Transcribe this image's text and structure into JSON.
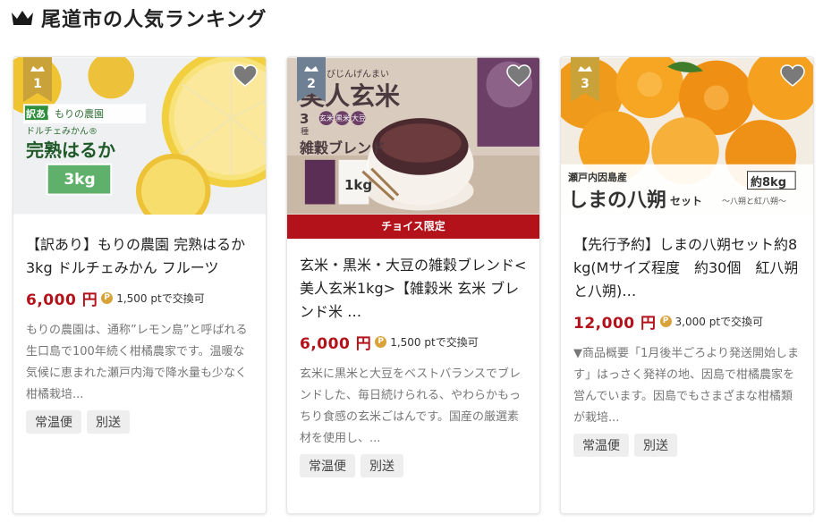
{
  "section": {
    "title": "尾道市の人気ランキング",
    "crown_icon": "crown-icon",
    "crown_color": "#1a1a1a"
  },
  "cards": [
    {
      "rank": "1",
      "rank_color": "#c9a23a",
      "image_text": {
        "tag": "訳あり",
        "farm": "もりの農園",
        "variety": "ドルチェみかん®",
        "name": "完熟はるか",
        "weight": "3kg"
      },
      "choice_label": "",
      "name": "【訳あり】もりの農園 完熟はるか 3kg ドルチェみかん フルーツ",
      "price": "6,000 円",
      "points": "1,500 ptで交換可",
      "description": "もりの農園は、通称”レモン島”と呼ばれる生口島で100年続く柑橘農家です。温暖な気候に恵まれた瀬戸内海で降水量も少なく柑橘栽培...",
      "tags": [
        "常温便",
        "別送"
      ]
    },
    {
      "rank": "2",
      "rank_color": "#6f7f94",
      "image_text": {
        "ruby": "びじんげんまい",
        "name": "美人玄米",
        "kinds_num": "3",
        "kinds": "種",
        "g1": "玄米",
        "g2": "黒米",
        "g3": "大豆",
        "blend": "雑穀ブレンド",
        "weight": "1kg"
      },
      "choice_label": "チョイス限定",
      "name": "玄米・黒米・大豆の雑穀ブレンド<美人玄米1kg>【雑穀米 玄米 ブレンド米 …",
      "price": "6,000 円",
      "points": "1,500 ptで交換可",
      "description": "玄米に黒米と大豆をベストバランスでブレンドした、毎日続けられる、やわらかもっちり食感の玄米ごはんです。国産の厳選素材を使用し、...",
      "tags": [
        "常温便",
        "別送"
      ]
    },
    {
      "rank": "3",
      "rank_color": "#c9a23a",
      "image_text": {
        "origin": "瀬戸内因島産",
        "weight": "約8kg",
        "name": "しまの八朔",
        "suffix": "セット",
        "sub": "～八朔と紅八朔～"
      },
      "choice_label": "",
      "name": "【先行予約】しまの八朔セット約8kg(Mサイズ程度　約30個　紅八朔と八朔)…",
      "price": "12,000 円",
      "points": "3,000 ptで交換可",
      "description": "▼商品概要「1月後半ごろより発送開始します」はっさく発祥の地、因島で柑橘農家を営んでいます。因島でもさまざまな柑橘類が栽培...",
      "tags": [
        "常温便",
        "別送"
      ]
    }
  ],
  "icons": {
    "favorite": "heart-icon",
    "point": "point-coin-icon",
    "point_glyph": "P"
  },
  "colors": {
    "price": "#b3121b",
    "choice_band": "#b3121b",
    "point_coin": "#d9a33a"
  }
}
